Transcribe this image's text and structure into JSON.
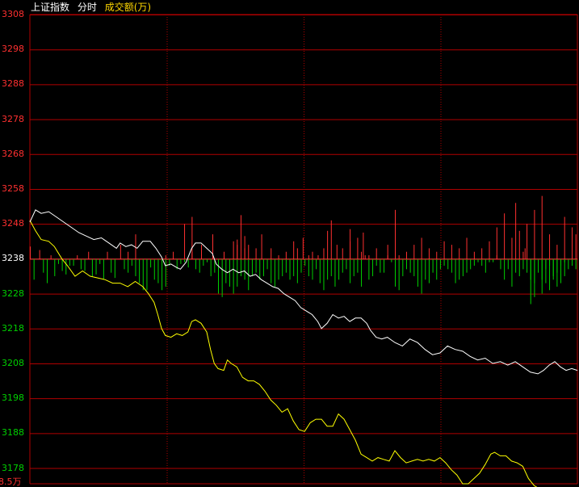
{
  "header": {
    "index_name": "上证指数",
    "mode": "分时",
    "volume_label": "成交额(万)"
  },
  "colors": {
    "background": "#000000",
    "grid": "#b00000",
    "up": "#ff3030",
    "down": "#00d000",
    "neutral": "#ffffff",
    "price_line": "#ffffff",
    "avg_line": "#ffff00",
    "header_text": "#ffffff",
    "header_vol": "#ffd700"
  },
  "chart_data": {
    "type": "line",
    "x_unit": "minute_index",
    "ylim": [
      3173.5,
      3308
    ],
    "base": 3238,
    "yticks": [
      3308,
      3298,
      3288,
      3278,
      3268,
      3258,
      3248,
      3238,
      3228,
      3218,
      3208,
      3198,
      3188,
      3178
    ],
    "bottom_tick_label": "8.5万",
    "price": [
      [
        0,
        3248.5
      ],
      [
        3,
        3252
      ],
      [
        6,
        3251
      ],
      [
        10,
        3251.5
      ],
      [
        14,
        3250
      ],
      [
        18,
        3248.5
      ],
      [
        22,
        3247
      ],
      [
        26,
        3245.5
      ],
      [
        30,
        3244.5
      ],
      [
        34,
        3243.5
      ],
      [
        38,
        3244
      ],
      [
        42,
        3242.5
      ],
      [
        46,
        3241
      ],
      [
        48,
        3242.5
      ],
      [
        51,
        3241.5
      ],
      [
        54,
        3242
      ],
      [
        57,
        3241
      ],
      [
        60,
        3243
      ],
      [
        64,
        3243
      ],
      [
        67,
        3241
      ],
      [
        70,
        3238.5
      ],
      [
        72,
        3236
      ],
      [
        75,
        3236.5
      ],
      [
        78,
        3235.5
      ],
      [
        80,
        3235
      ],
      [
        83,
        3237
      ],
      [
        86,
        3241
      ],
      [
        88,
        3242.5
      ],
      [
        91,
        3242.5
      ],
      [
        94,
        3241
      ],
      [
        97,
        3239.5
      ],
      [
        99,
        3236.5
      ],
      [
        102,
        3235
      ],
      [
        105,
        3234
      ],
      [
        108,
        3235
      ],
      [
        111,
        3234
      ],
      [
        114,
        3234.5
      ],
      [
        117,
        3233
      ],
      [
        120,
        3233.5
      ],
      [
        123,
        3232
      ],
      [
        126,
        3231
      ],
      [
        129,
        3230
      ],
      [
        132,
        3229.5
      ],
      [
        135,
        3228
      ],
      [
        138,
        3227
      ],
      [
        141,
        3226
      ],
      [
        144,
        3224
      ],
      [
        147,
        3223
      ],
      [
        150,
        3222
      ],
      [
        153,
        3220
      ],
      [
        155,
        3218
      ],
      [
        158,
        3219.5
      ],
      [
        161,
        3222
      ],
      [
        164,
        3221
      ],
      [
        167,
        3221.5
      ],
      [
        170,
        3220
      ],
      [
        173,
        3221
      ],
      [
        176,
        3221
      ],
      [
        179,
        3219.5
      ],
      [
        181,
        3217.5
      ],
      [
        184,
        3215.5
      ],
      [
        187,
        3215
      ],
      [
        190,
        3215.5
      ],
      [
        194,
        3214
      ],
      [
        198,
        3213
      ],
      [
        202,
        3215
      ],
      [
        206,
        3214
      ],
      [
        210,
        3212
      ],
      [
        214,
        3210.5
      ],
      [
        218,
        3211
      ],
      [
        222,
        3213
      ],
      [
        226,
        3212
      ],
      [
        230,
        3211.5
      ],
      [
        234,
        3210
      ],
      [
        238,
        3209
      ],
      [
        242,
        3209.5
      ],
      [
        246,
        3208
      ],
      [
        250,
        3208.5
      ],
      [
        254,
        3207.5
      ],
      [
        258,
        3208.5
      ],
      [
        262,
        3207
      ],
      [
        266,
        3205.5
      ],
      [
        270,
        3205
      ],
      [
        273,
        3206
      ],
      [
        276,
        3207.5
      ],
      [
        279,
        3208.5
      ],
      [
        282,
        3207
      ],
      [
        285,
        3206
      ],
      [
        288,
        3206.5
      ],
      [
        291,
        3206
      ]
    ],
    "avg": [
      [
        0,
        3249
      ],
      [
        3,
        3246
      ],
      [
        6,
        3243.5
      ],
      [
        10,
        3243
      ],
      [
        13,
        3241.5
      ],
      [
        17,
        3238
      ],
      [
        20,
        3236
      ],
      [
        24,
        3233
      ],
      [
        28,
        3234.5
      ],
      [
        32,
        3233
      ],
      [
        36,
        3232.5
      ],
      [
        40,
        3232
      ],
      [
        44,
        3231
      ],
      [
        48,
        3231
      ],
      [
        52,
        3230
      ],
      [
        56,
        3231.5
      ],
      [
        60,
        3230
      ],
      [
        63,
        3228
      ],
      [
        66,
        3225.5
      ],
      [
        68,
        3222
      ],
      [
        70,
        3218
      ],
      [
        72,
        3216
      ],
      [
        75,
        3215.5
      ],
      [
        78,
        3216.5
      ],
      [
        81,
        3216
      ],
      [
        84,
        3217
      ],
      [
        86,
        3220
      ],
      [
        88,
        3220.5
      ],
      [
        91,
        3219.5
      ],
      [
        94,
        3217
      ],
      [
        96,
        3212
      ],
      [
        98,
        3208
      ],
      [
        100,
        3206.5
      ],
      [
        103,
        3206
      ],
      [
        105,
        3209
      ],
      [
        107,
        3208
      ],
      [
        110,
        3207
      ],
      [
        113,
        3204
      ],
      [
        116,
        3203
      ],
      [
        119,
        3203
      ],
      [
        122,
        3202
      ],
      [
        125,
        3200
      ],
      [
        128,
        3197.5
      ],
      [
        131,
        3196
      ],
      [
        134,
        3194
      ],
      [
        137,
        3195
      ],
      [
        140,
        3191.5
      ],
      [
        143,
        3189
      ],
      [
        146,
        3188.5
      ],
      [
        149,
        3191
      ],
      [
        152,
        3192
      ],
      [
        155,
        3192
      ],
      [
        158,
        3190
      ],
      [
        161,
        3190
      ],
      [
        164,
        3193.5
      ],
      [
        167,
        3192
      ],
      [
        170,
        3189
      ],
      [
        173,
        3186
      ],
      [
        176,
        3182
      ],
      [
        179,
        3181
      ],
      [
        182,
        3180
      ],
      [
        185,
        3181
      ],
      [
        188,
        3180.5
      ],
      [
        191,
        3180
      ],
      [
        194,
        3183
      ],
      [
        197,
        3181
      ],
      [
        200,
        3179.5
      ],
      [
        203,
        3180
      ],
      [
        206,
        3180.5
      ],
      [
        209,
        3180
      ],
      [
        212,
        3180.5
      ],
      [
        215,
        3180
      ],
      [
        218,
        3181
      ],
      [
        221,
        3179.5
      ],
      [
        224,
        3177.5
      ],
      [
        227,
        3176
      ],
      [
        230,
        3173.5
      ],
      [
        233,
        3173.5
      ],
      [
        236,
        3175
      ],
      [
        239,
        3176.5
      ],
      [
        242,
        3179
      ],
      [
        245,
        3182
      ],
      [
        247,
        3182.5
      ],
      [
        250,
        3181.5
      ],
      [
        253,
        3181.5
      ],
      [
        256,
        3180
      ],
      [
        259,
        3179.5
      ],
      [
        262,
        3178.5
      ],
      [
        265,
        3175
      ],
      [
        268,
        3173
      ],
      [
        271,
        3172
      ],
      [
        274,
        3171
      ],
      [
        277,
        3170
      ],
      [
        280,
        3169.5
      ],
      [
        283,
        3169.2
      ],
      [
        286,
        3169
      ],
      [
        291,
        3169
      ]
    ],
    "bars": [
      [
        0,
        3.5
      ],
      [
        2,
        -6
      ],
      [
        5,
        2.5
      ],
      [
        7,
        -4
      ],
      [
        9,
        -7
      ],
      [
        11,
        1
      ],
      [
        13,
        -5
      ],
      [
        15,
        -1.5
      ],
      [
        17,
        -3.5
      ],
      [
        19,
        -4.5
      ],
      [
        21,
        -2
      ],
      [
        23,
        -2
      ],
      [
        25,
        1
      ],
      [
        27,
        -3
      ],
      [
        29,
        -3.5
      ],
      [
        31,
        2
      ],
      [
        33,
        -5
      ],
      [
        35,
        -4.5
      ],
      [
        37,
        -1.5
      ],
      [
        39,
        -6
      ],
      [
        41,
        2
      ],
      [
        43,
        -4
      ],
      [
        45,
        -5.5
      ],
      [
        48,
        4
      ],
      [
        50,
        -3
      ],
      [
        52,
        -4
      ],
      [
        54,
        -2
      ],
      [
        56,
        -5
      ],
      [
        58,
        -7
      ],
      [
        60,
        -9
      ],
      [
        62,
        -9
      ],
      [
        64,
        -2.5
      ],
      [
        66,
        -6
      ],
      [
        68,
        -7
      ],
      [
        70,
        -9
      ],
      [
        72,
        -8
      ],
      [
        74,
        -2
      ],
      [
        76,
        2
      ],
      [
        78,
        -3
      ],
      [
        80,
        -1.5
      ],
      [
        82,
        -1
      ],
      [
        84,
        -2.5
      ],
      [
        86,
        2
      ],
      [
        88,
        -3
      ],
      [
        90,
        -4
      ],
      [
        92,
        -2
      ],
      [
        94,
        -1
      ],
      [
        96,
        -5
      ],
      [
        98,
        -4
      ],
      [
        100,
        -10
      ],
      [
        102,
        -11
      ],
      [
        104,
        -7
      ],
      [
        106,
        -8
      ],
      [
        108,
        -10
      ],
      [
        110,
        -8
      ],
      [
        112,
        -5
      ],
      [
        114,
        -6
      ],
      [
        116,
        -9
      ],
      [
        118,
        -5
      ],
      [
        120,
        -4
      ],
      [
        122,
        -6
      ],
      [
        124,
        -5
      ],
      [
        126,
        -3
      ],
      [
        128,
        -7
      ],
      [
        130,
        -8
      ],
      [
        132,
        -6
      ],
      [
        134,
        -5
      ],
      [
        136,
        -4
      ],
      [
        138,
        -6
      ],
      [
        140,
        -5
      ],
      [
        142,
        -7
      ],
      [
        144,
        -4
      ],
      [
        146,
        -2
      ],
      [
        148,
        -5
      ],
      [
        150,
        -6
      ],
      [
        152,
        -3
      ],
      [
        154,
        -7
      ],
      [
        156,
        -9
      ],
      [
        158,
        -6
      ],
      [
        160,
        -5
      ],
      [
        162,
        -8
      ],
      [
        164,
        -6
      ],
      [
        166,
        -4
      ],
      [
        168,
        -3
      ],
      [
        170,
        -7
      ],
      [
        172,
        -5
      ],
      [
        174,
        -4
      ],
      [
        176,
        -8
      ],
      [
        178,
        1
      ],
      [
        180,
        -6
      ],
      [
        182,
        -5
      ],
      [
        184,
        -2
      ],
      [
        186,
        -4
      ],
      [
        188,
        -4
      ],
      [
        190,
        1
      ],
      [
        192,
        -1
      ],
      [
        194,
        -8
      ],
      [
        196,
        -9
      ],
      [
        198,
        -5
      ],
      [
        200,
        -3
      ],
      [
        202,
        -4
      ],
      [
        204,
        -5
      ],
      [
        206,
        -8
      ],
      [
        208,
        -10
      ],
      [
        210,
        -6
      ],
      [
        212,
        -7
      ],
      [
        214,
        -4
      ],
      [
        216,
        -6
      ],
      [
        218,
        -3
      ],
      [
        220,
        -2
      ],
      [
        222,
        -3
      ],
      [
        224,
        -4
      ],
      [
        226,
        -7
      ],
      [
        228,
        -6
      ],
      [
        230,
        -5
      ],
      [
        232,
        -4
      ],
      [
        234,
        -3
      ],
      [
        236,
        -2
      ],
      [
        238,
        -1
      ],
      [
        240,
        -2
      ],
      [
        242,
        -4
      ],
      [
        244,
        -1
      ],
      [
        246,
        -1
      ],
      [
        248,
        1
      ],
      [
        250,
        -3
      ],
      [
        252,
        -6
      ],
      [
        254,
        -3
      ],
      [
        256,
        -8
      ],
      [
        258,
        -4
      ],
      [
        260,
        -5
      ],
      [
        262,
        -3
      ],
      [
        264,
        -4
      ],
      [
        266,
        -6
      ],
      [
        268,
        -7
      ],
      [
        270,
        -4
      ],
      [
        272,
        -6
      ],
      [
        274,
        -3
      ],
      [
        276,
        -2
      ],
      [
        278,
        -5
      ],
      [
        280,
        -4
      ],
      [
        282,
        -2
      ],
      [
        284,
        -1
      ],
      [
        286,
        -3
      ],
      [
        288,
        -2
      ],
      [
        290,
        -3
      ],
      [
        52,
        2
      ],
      [
        56,
        7
      ],
      [
        72,
        1
      ],
      [
        82,
        10
      ],
      [
        86,
        12
      ],
      [
        91,
        4
      ],
      [
        97,
        7
      ],
      [
        103,
        2
      ],
      [
        108,
        5
      ],
      [
        110,
        4
      ],
      [
        114,
        3
      ],
      [
        120,
        3
      ],
      [
        123,
        7
      ],
      [
        128,
        3
      ],
      [
        132,
        1
      ],
      [
        136,
        2
      ],
      [
        140,
        5
      ],
      [
        142,
        3
      ],
      [
        145,
        6
      ],
      [
        148,
        1
      ],
      [
        150,
        2
      ],
      [
        153,
        1
      ],
      [
        156,
        3
      ],
      [
        158,
        8
      ],
      [
        160,
        11
      ],
      [
        163,
        4
      ],
      [
        166,
        3
      ],
      [
        170,
        5
      ],
      [
        174,
        6
      ],
      [
        176,
        2
      ],
      [
        180,
        1
      ],
      [
        184,
        3
      ],
      [
        190,
        4
      ],
      [
        194,
        3
      ],
      [
        200,
        2
      ],
      [
        204,
        4
      ],
      [
        208,
        6
      ],
      [
        212,
        3
      ],
      [
        216,
        2
      ],
      [
        220,
        5
      ],
      [
        224,
        4
      ],
      [
        228,
        3
      ],
      [
        232,
        6
      ],
      [
        236,
        2
      ],
      [
        240,
        3
      ],
      [
        244,
        5
      ],
      [
        248,
        9
      ],
      [
        252,
        13
      ],
      [
        256,
        6
      ],
      [
        260,
        8
      ],
      [
        264,
        10
      ],
      [
        268,
        14
      ],
      [
        272,
        18
      ],
      [
        276,
        7
      ],
      [
        280,
        4
      ],
      [
        284,
        12
      ],
      [
        288,
        9
      ],
      [
        290,
        7
      ],
      [
        110,
        5.5
      ],
      [
        112,
        12.5
      ],
      [
        114,
        6.5
      ],
      [
        116,
        4
      ],
      [
        170,
        8.5
      ],
      [
        177,
        7.5
      ],
      [
        194,
        14
      ],
      [
        196,
        1
      ],
      [
        258,
        16
      ],
      [
        262,
        2
      ],
      [
        263,
        3
      ],
      [
        266,
        -13
      ],
      [
        268,
        -11
      ],
      [
        272,
        -10
      ],
      [
        274,
        -7
      ],
      [
        276,
        -9
      ],
      [
        278,
        -6
      ],
      [
        280,
        -8
      ],
      [
        282,
        -7
      ],
      [
        284,
        -5
      ]
    ]
  }
}
